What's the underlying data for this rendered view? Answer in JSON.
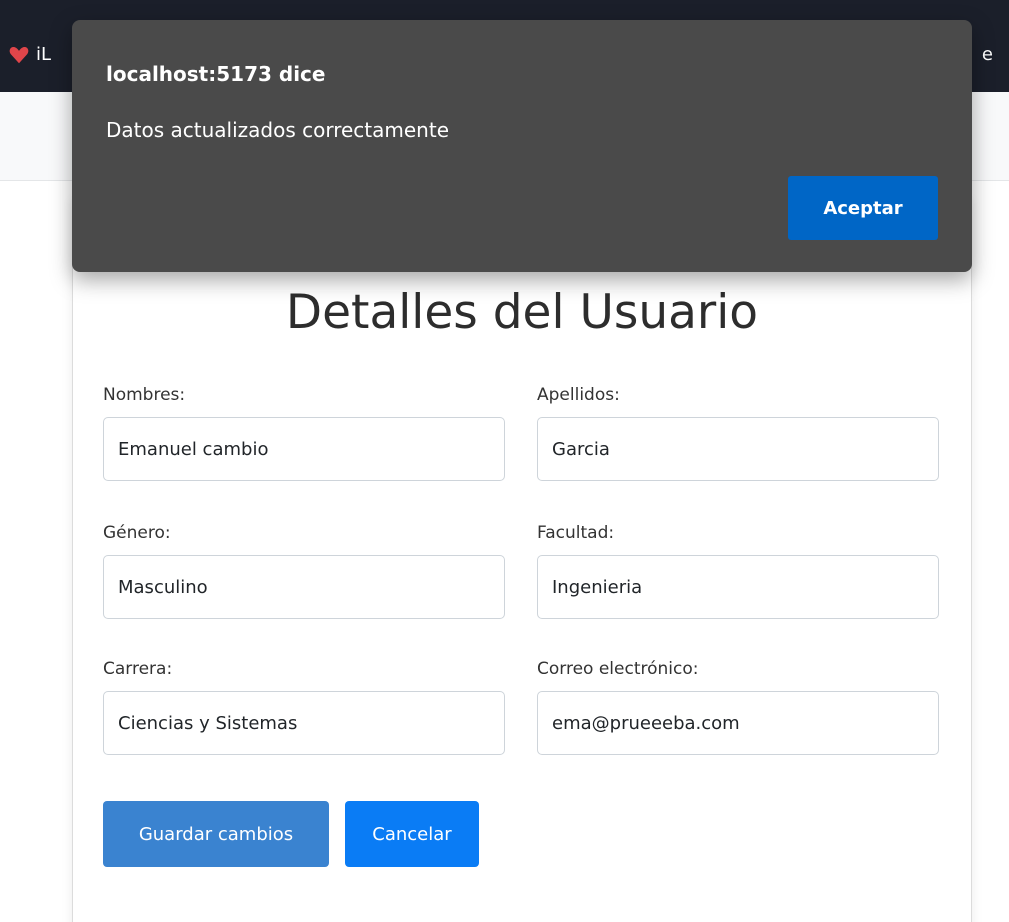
{
  "navbar": {
    "brand_text": "iL",
    "right_text": "e",
    "brand_icon": "heart-icon",
    "background": "#1b1f2a"
  },
  "dialog": {
    "title": "localhost:5173 dice",
    "message": "Datos actualizados correctamente",
    "accept_label": "Aceptar",
    "accept_color": "#0066c6",
    "background": "#4a4a4a"
  },
  "form": {
    "title": "Detalles del Usuario",
    "fields": {
      "nombres": {
        "label": "Nombres:",
        "value": "Emanuel cambio"
      },
      "apellidos": {
        "label": "Apellidos:",
        "value": "Garcia"
      },
      "genero": {
        "label": "Género:",
        "value": "Masculino"
      },
      "facultad": {
        "label": "Facultad:",
        "value": "Ingenieria"
      },
      "carrera": {
        "label": "Carrera:",
        "value": "Ciencias y Sistemas"
      },
      "correo": {
        "label": "Correo electrónico:",
        "value": "ema@prueeeba.com"
      }
    },
    "buttons": {
      "save_label": "Guardar cambios",
      "cancel_label": "Cancelar",
      "save_color": "#3a83d0",
      "cancel_color": "#0a7cf5"
    }
  }
}
